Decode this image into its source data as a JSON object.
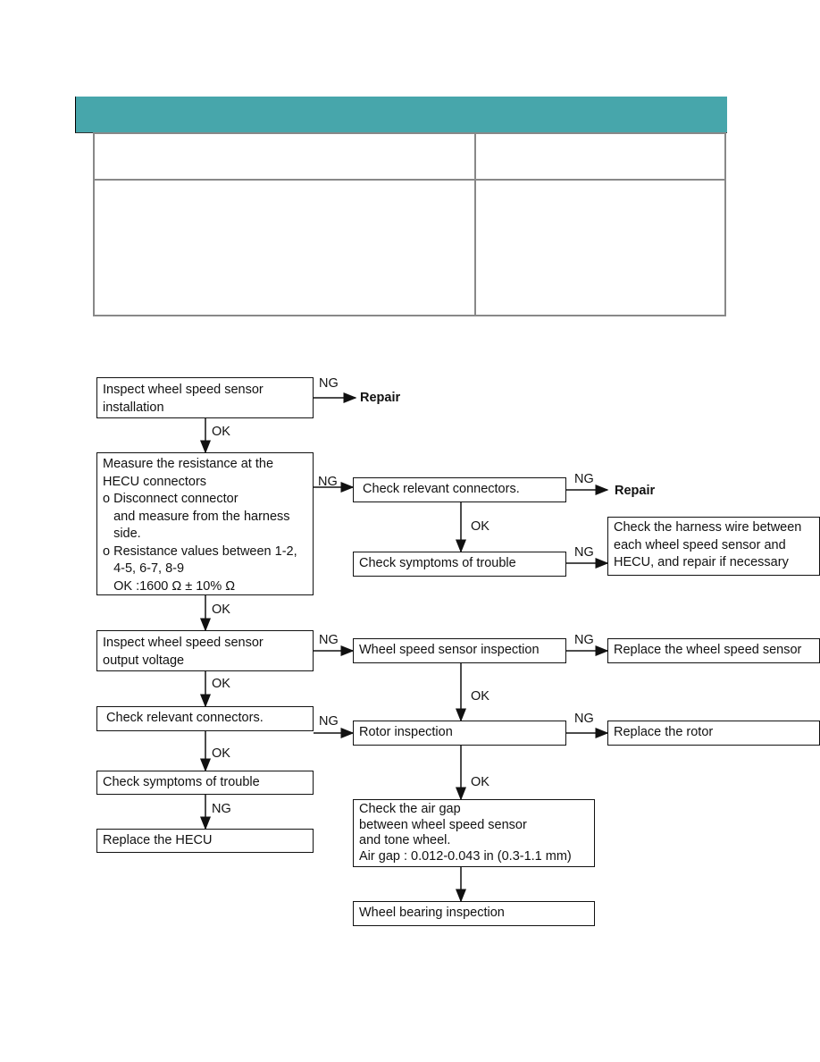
{
  "header": {
    "color": "#47a6ab"
  },
  "flowchart": {
    "nodes": {
      "inspect_installation": "Inspect wheel speed sensor\ninstallation",
      "repair_1": "Repair",
      "measure_resistance": "Measure the resistance at the\nHECU connectors\no Disconnect connector\n   and measure from the harness\n   side.\no Resistance values between 1-2,\n   4-5, 6-7, 8-9\n   OK :1600 Ω ± 10% Ω",
      "check_connectors_right": " Check relevant connectors.",
      "repair_2": "Repair",
      "check_symptoms_right": "Check symptoms of trouble",
      "check_harness": "Check the harness wire between\neach wheel speed sensor and\nHECU, and repair if necessary",
      "inspect_output_voltage": "Inspect wheel speed sensor\noutput voltage",
      "sensor_inspection": "Wheel speed sensor inspection",
      "replace_sensor": "Replace the wheel speed sensor",
      "check_connectors_left": " Check relevant connectors.",
      "rotor_inspection": "Rotor inspection",
      "replace_rotor": "Replace the rotor",
      "check_symptoms_left": "Check symptoms of trouble",
      "replace_hecu": "Replace the HECU",
      "check_air_gap": "Check the air gap\nbetween wheel speed sensor\nand tone wheel.\nAir gap : 0.012-0.043 in (0.3-1.1 mm)",
      "wheel_bearing": "Wheel bearing inspection"
    },
    "labels": {
      "ng": "NG",
      "ok": "OK"
    }
  }
}
